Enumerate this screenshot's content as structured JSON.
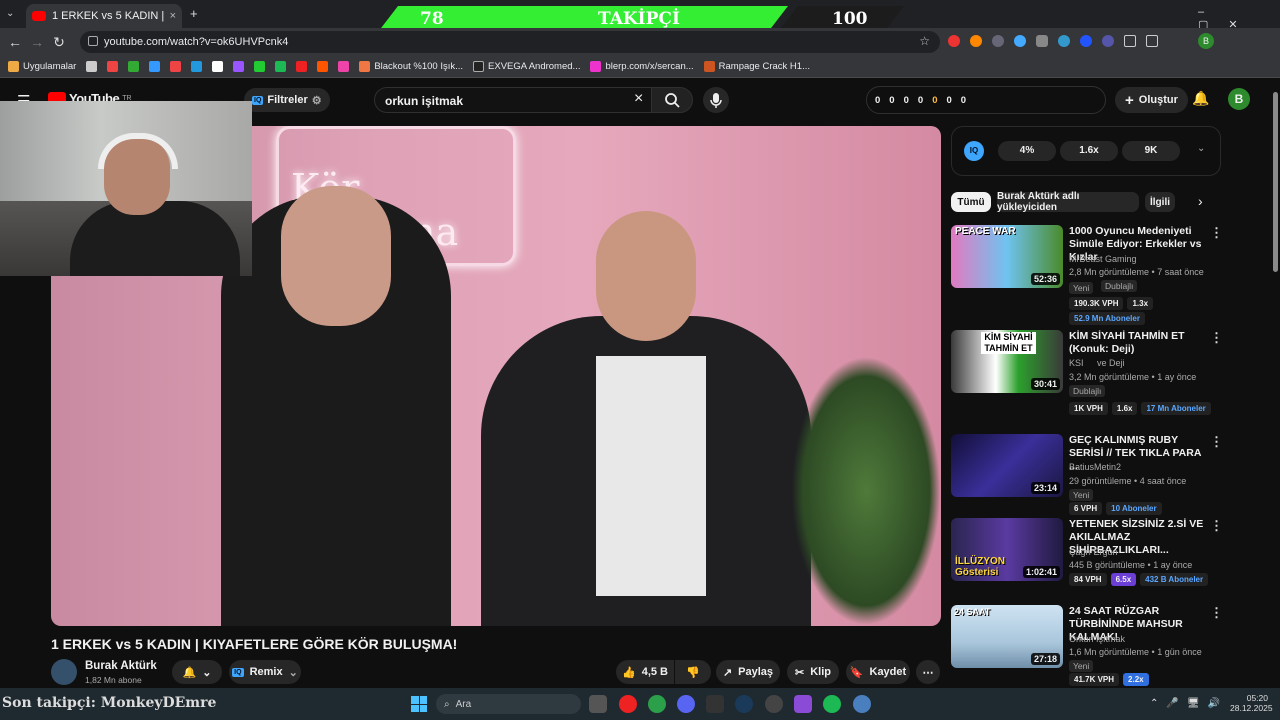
{
  "browser": {
    "tab_title": "1 ERKEK vs 5 KADIN | KIYAFETLE",
    "url": "youtube.com/watch?v=ok6UHVPcnk4",
    "new_tab": "+",
    "bookmarks": [
      "Uygulamalar",
      "Blackout %100 Işık...",
      "EXVEGA Andromed...",
      "blerp.com/x/sercan...",
      "Rampage Crack H1..."
    ]
  },
  "overlay": {
    "left_count": "78",
    "label": "TAKİPÇİ",
    "right_count": "100",
    "last_follower": "Son takipçi: MonkeyDEmre"
  },
  "youtube": {
    "logo": "YouTube",
    "logo_sup": "TR",
    "filters": "Filtreler",
    "search_value": "orkun işitmak",
    "counters": [
      "0",
      "0",
      "0",
      "0",
      "0",
      "0",
      "0"
    ],
    "create": "Oluştur",
    "avatar": "B"
  },
  "video": {
    "title": "1 ERKEK vs 5 KADIN | KIYAFETLERE GÖRE KÖR BULUŞMA!",
    "channel": "Burak Aktürk",
    "subs": "1,82 Mn abone",
    "remix": "Remix",
    "likes": "4,5 B",
    "share": "Paylaş",
    "clip": "Klip",
    "save": "Kaydet",
    "neon_text": "Kör Buluşma"
  },
  "sidebar": {
    "iq_stats": [
      "4%",
      "1.6x",
      "9K"
    ],
    "chips": [
      "Tümü",
      "Burak Aktürk adlı yükleyiciden",
      "İlgili"
    ],
    "items": [
      {
        "title": "1000 Oyuncu Medeniyeti Simüle Ediyor: Erkekler vs Kızlar",
        "channel": "MrBeast Gaming",
        "meta": "2,8 Mn görüntüleme • 7 saat önce",
        "badges": [
          "Yeni",
          "Dublajlı"
        ],
        "stats": [
          "190.3K VPH",
          "1.3x",
          "52.9 Mn Aboneler"
        ],
        "duration": "52:36",
        "thumb_text": "PEACE   WAR",
        "thumb_color": "#6fc3f0"
      },
      {
        "title": "KİM SİYAHİ TAHMİN ET (Konuk: Deji)",
        "channel": "KSI",
        "channel2": "ve Deji",
        "meta": "3,2 Mn görüntüleme • 1 ay önce",
        "badges": [
          "Dublajlı"
        ],
        "stats": [
          "1K VPH",
          "1.6x",
          "17 Mn Aboneler"
        ],
        "duration": "30:41",
        "thumb_text": "KİM SİYAHİ TAHMİN ET",
        "thumb_color": "#3a3a3a"
      },
      {
        "title": "GEÇ KALINMIŞ RUBY SERİSİ // TEK TIKLA PARA ...",
        "channel": "BatiusMetin2",
        "meta": "29 görüntüleme • 4 saat önce",
        "badges": [
          "Yeni"
        ],
        "stats": [
          "6 VPH",
          "10 Aboneler"
        ],
        "duration": "23:14",
        "thumb_text": "",
        "thumb_color": "#1b1740"
      },
      {
        "title": "YETENEK SİZSİNİZ 2.Sİ VE AKILALMAZ SİHİRBAZLIKLARI...",
        "channel": "Çağrı Ergün",
        "meta": "445 B görüntüleme • 1 ay önce",
        "badges": [],
        "stats": [
          "84 VPH",
          "6.5x",
          "432 B Aboneler"
        ],
        "duration": "1:02:41",
        "thumb_text": "İLLÜZYON Gösterisi",
        "thumb_color": "#2a2550"
      },
      {
        "title": "24 SAAT RÜZGAR TÜRBİNİNDE MAHSUR KALMAK!",
        "channel": "Orkun Işıtmak",
        "meta": "1,6 Mn görüntüleme • 1 gün önce",
        "badges": [
          "Yeni"
        ],
        "stats": [
          "41.7K VPH",
          "2.2x"
        ],
        "duration": "27:18",
        "thumb_text": "24 SAAT",
        "thumb_color": "#a9c6dc"
      }
    ]
  },
  "taskbar": {
    "search": "Ara",
    "time": "05:20",
    "date": "28.12.2025"
  }
}
